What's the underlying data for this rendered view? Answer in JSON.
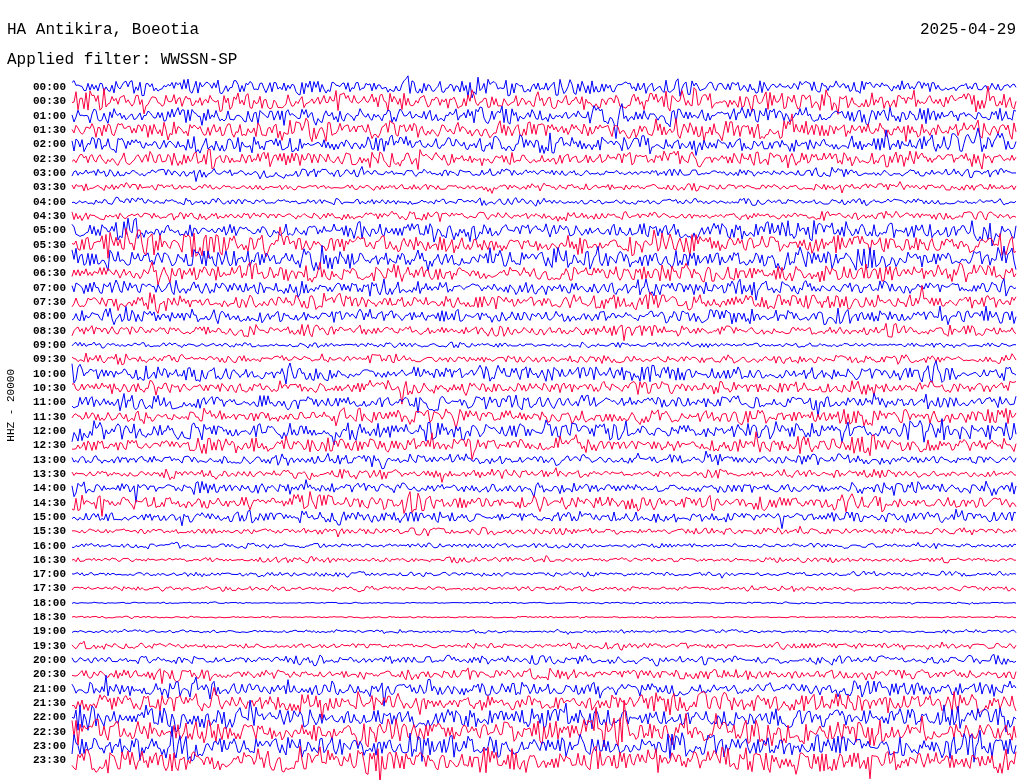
{
  "header": {
    "station": "HA Antikira, Boeotia",
    "date": "2025-04-29",
    "filter": "Applied filter: WWSSN-SP"
  },
  "helicorder": {
    "axis_label": "HHZ - 20000",
    "rows": [
      {
        "time": "00:00",
        "color": "#0000ff"
      },
      {
        "time": "00:30",
        "color": "#ff0040"
      },
      {
        "time": "01:00",
        "color": "#0000ff"
      },
      {
        "time": "01:30",
        "color": "#ff0040"
      },
      {
        "time": "02:00",
        "color": "#0000ff"
      },
      {
        "time": "02:30",
        "color": "#ff0040"
      },
      {
        "time": "03:00",
        "color": "#0000ff"
      },
      {
        "time": "03:30",
        "color": "#ff0040"
      },
      {
        "time": "04:00",
        "color": "#0000ff"
      },
      {
        "time": "04:30",
        "color": "#ff0040"
      },
      {
        "time": "05:00",
        "color": "#0000ff"
      },
      {
        "time": "05:30",
        "color": "#ff0040"
      },
      {
        "time": "06:00",
        "color": "#0000ff"
      },
      {
        "time": "06:30",
        "color": "#ff0040"
      },
      {
        "time": "07:00",
        "color": "#0000ff"
      },
      {
        "time": "07:30",
        "color": "#ff0040"
      },
      {
        "time": "08:00",
        "color": "#0000ff"
      },
      {
        "time": "08:30",
        "color": "#ff0040"
      },
      {
        "time": "09:00",
        "color": "#0000ff"
      },
      {
        "time": "09:30",
        "color": "#ff0040"
      },
      {
        "time": "10:00",
        "color": "#0000ff"
      },
      {
        "time": "10:30",
        "color": "#ff0040"
      },
      {
        "time": "11:00",
        "color": "#0000ff"
      },
      {
        "time": "11:30",
        "color": "#ff0040"
      },
      {
        "time": "12:00",
        "color": "#0000ff"
      },
      {
        "time": "12:30",
        "color": "#ff0040"
      },
      {
        "time": "13:00",
        "color": "#0000ff"
      },
      {
        "time": "13:30",
        "color": "#ff0040"
      },
      {
        "time": "14:00",
        "color": "#0000ff"
      },
      {
        "time": "14:30",
        "color": "#ff0040"
      },
      {
        "time": "15:00",
        "color": "#0000ff"
      },
      {
        "time": "15:30",
        "color": "#ff0040"
      },
      {
        "time": "16:00",
        "color": "#0000ff"
      },
      {
        "time": "16:30",
        "color": "#ff0040"
      },
      {
        "time": "17:00",
        "color": "#0000ff"
      },
      {
        "time": "17:30",
        "color": "#ff0040"
      },
      {
        "time": "18:00",
        "color": "#0000ff"
      },
      {
        "time": "18:30",
        "color": "#ff0040"
      },
      {
        "time": "19:00",
        "color": "#0000ff"
      },
      {
        "time": "19:30",
        "color": "#ff0040"
      },
      {
        "time": "20:00",
        "color": "#0000ff"
      },
      {
        "time": "20:30",
        "color": "#ff0040"
      },
      {
        "time": "21:00",
        "color": "#0000ff"
      },
      {
        "time": "21:30",
        "color": "#ff0040"
      },
      {
        "time": "22:00",
        "color": "#0000ff"
      },
      {
        "time": "22:30",
        "color": "#ff0040"
      },
      {
        "time": "23:00",
        "color": "#0000ff"
      },
      {
        "time": "23:30",
        "color": "#ff0040"
      }
    ]
  }
}
